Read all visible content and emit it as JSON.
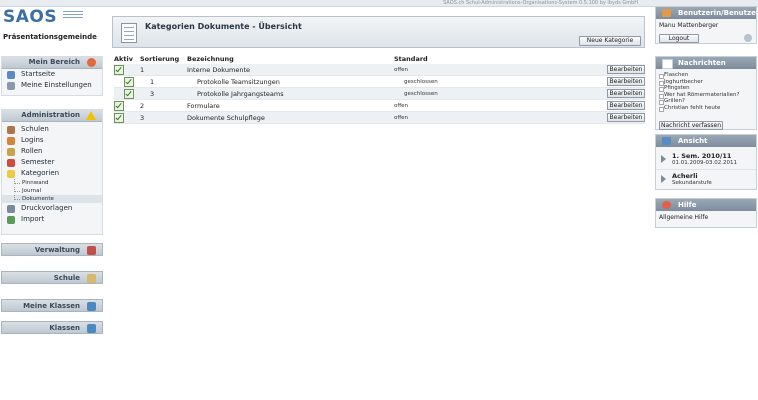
{
  "app": {
    "logo": "SAOS",
    "subtitle": "Präsentationsgemeinde",
    "version_text": "SAOS.ch Schul-Administrations-Organisations-System 0.5.100 by ibyds GmbH"
  },
  "sidebar": {
    "mein_bereich": {
      "title": "Mein Bereich",
      "items": [
        {
          "label": "Startseite",
          "icon": "home-icon"
        },
        {
          "label": "Meine Einstellungen",
          "icon": "settings-icon"
        }
      ]
    },
    "administration": {
      "title": "Administration",
      "items": [
        {
          "label": "Schulen",
          "icon": "school-icon"
        },
        {
          "label": "Logins",
          "icon": "users-icon"
        },
        {
          "label": "Rollen",
          "icon": "roles-icon"
        },
        {
          "label": "Semester",
          "icon": "calendar-icon"
        },
        {
          "label": "Kategorien",
          "icon": "folder-icon"
        }
      ],
      "sub_items": [
        "Pinnwand",
        "Journal",
        "Dokumente"
      ],
      "items_after": [
        {
          "label": "Druckvorlagen",
          "icon": "print-icon"
        },
        {
          "label": "Import",
          "icon": "import-icon"
        }
      ]
    },
    "collapsed": [
      "Verwaltung",
      "Schule",
      "Meine Klassen",
      "Klassen"
    ]
  },
  "main": {
    "title": "Kategorien Dokumente - Übersicht",
    "new_button": "Neue Kategorie",
    "columns": [
      "Aktiv",
      "Sortierung",
      "Bezeichnung",
      "Standard"
    ],
    "rows": [
      {
        "sort": "1",
        "name": "Interne Dokumente",
        "standard": "offen",
        "level": 0,
        "action": "Bearbeiten"
      },
      {
        "sort": "1",
        "name": "Protokolle Teamsitzungen",
        "standard": "geschlossen",
        "level": 1,
        "action": "Bearbeiten"
      },
      {
        "sort": "3",
        "name": "Protokolle Jahrgangsteams",
        "standard": "geschlossen",
        "level": 1,
        "action": "Bearbeiten"
      },
      {
        "sort": "2",
        "name": "Formulare",
        "standard": "offen",
        "level": 0,
        "action": "Bearbeiten"
      },
      {
        "sort": "3",
        "name": "Dokumente Schulpflege",
        "standard": "offen",
        "level": 0,
        "action": "Bearbeiten"
      }
    ]
  },
  "right": {
    "user": {
      "title": "Benutzerin/Benutzer",
      "name": "Manu Mattenberger",
      "logout": "Logout"
    },
    "messages": {
      "title": "Nachrichten",
      "items": [
        "Flaschen",
        "Joghurtbecher",
        "Pfingsten",
        "Wer hat Römermaterialien?",
        "Grillen?",
        "Christian fehlt heute"
      ],
      "compose": "Nachricht verfassen"
    },
    "view": {
      "title": "Ansicht",
      "semester": "1. Sem. 2010/11",
      "dates": "01.01.2009-03.02.2011",
      "school": "Acherli",
      "level": "Sekundarstufe"
    },
    "help": {
      "title": "Hilfe",
      "link": "Allgemeine Hilfe"
    }
  },
  "colors": {
    "accent": "#3a6ea5",
    "header_gradient": "#7d8c9b"
  }
}
